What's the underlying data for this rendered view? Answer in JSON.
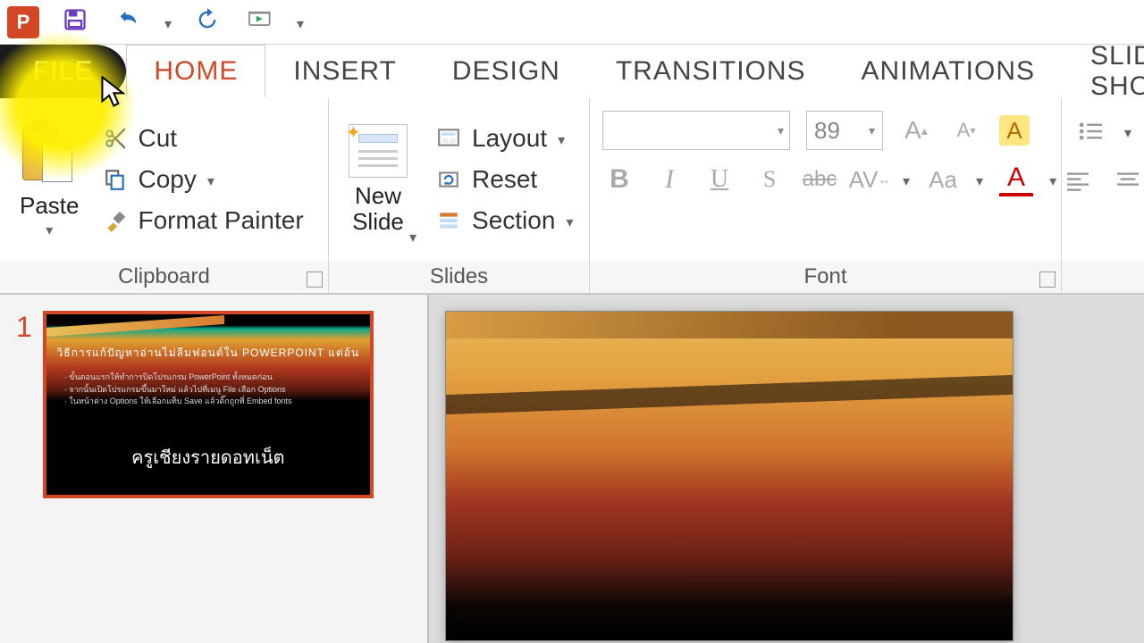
{
  "qat": {
    "undo_dropdown": "▾",
    "more": "▾"
  },
  "tabs": {
    "file": "FILE",
    "home": "HOME",
    "insert": "INSERT",
    "design": "DESIGN",
    "transitions": "TRANSITIONS",
    "animations": "ANIMATIONS",
    "slideshow": "SLIDE SHOW"
  },
  "clipboard": {
    "paste": "Paste",
    "cut": "Cut",
    "copy": "Copy",
    "format_painter": "Format Painter",
    "group": "Clipboard"
  },
  "slides": {
    "new_slide": "New\nSlide",
    "layout": "Layout",
    "reset": "Reset",
    "section": "Section",
    "group": "Slides"
  },
  "font": {
    "size": "89",
    "group": "Font",
    "bold": "B",
    "italic": "I",
    "underline": "U",
    "strike": "S",
    "abc": "abc",
    "spacing": "AV",
    "case": "Aa",
    "color": "A"
  },
  "thumbnails": {
    "items": [
      {
        "num": "1",
        "title": "วิธีการแก้ปัญหาอ่านไม่ลืมฟอนต์ใน POWERPOINT แต่อ้น",
        "bullets": "· ขั้นตอนแรกให้ทำการปิดโปรแกรม PowerPoint ทั้งหมดก่อน\n· จากนั้นเปิดโปรแกรมขึ้นมาใหม่ แล้วไปที่เมนู File เลือก Options\n· ในหน้าต่าง Options ให้เลือกแท็บ Save แล้วติ๊กถูกที่ Embed fonts",
        "credit": "ครูเชียงรายดอทเน็ต"
      }
    ]
  }
}
